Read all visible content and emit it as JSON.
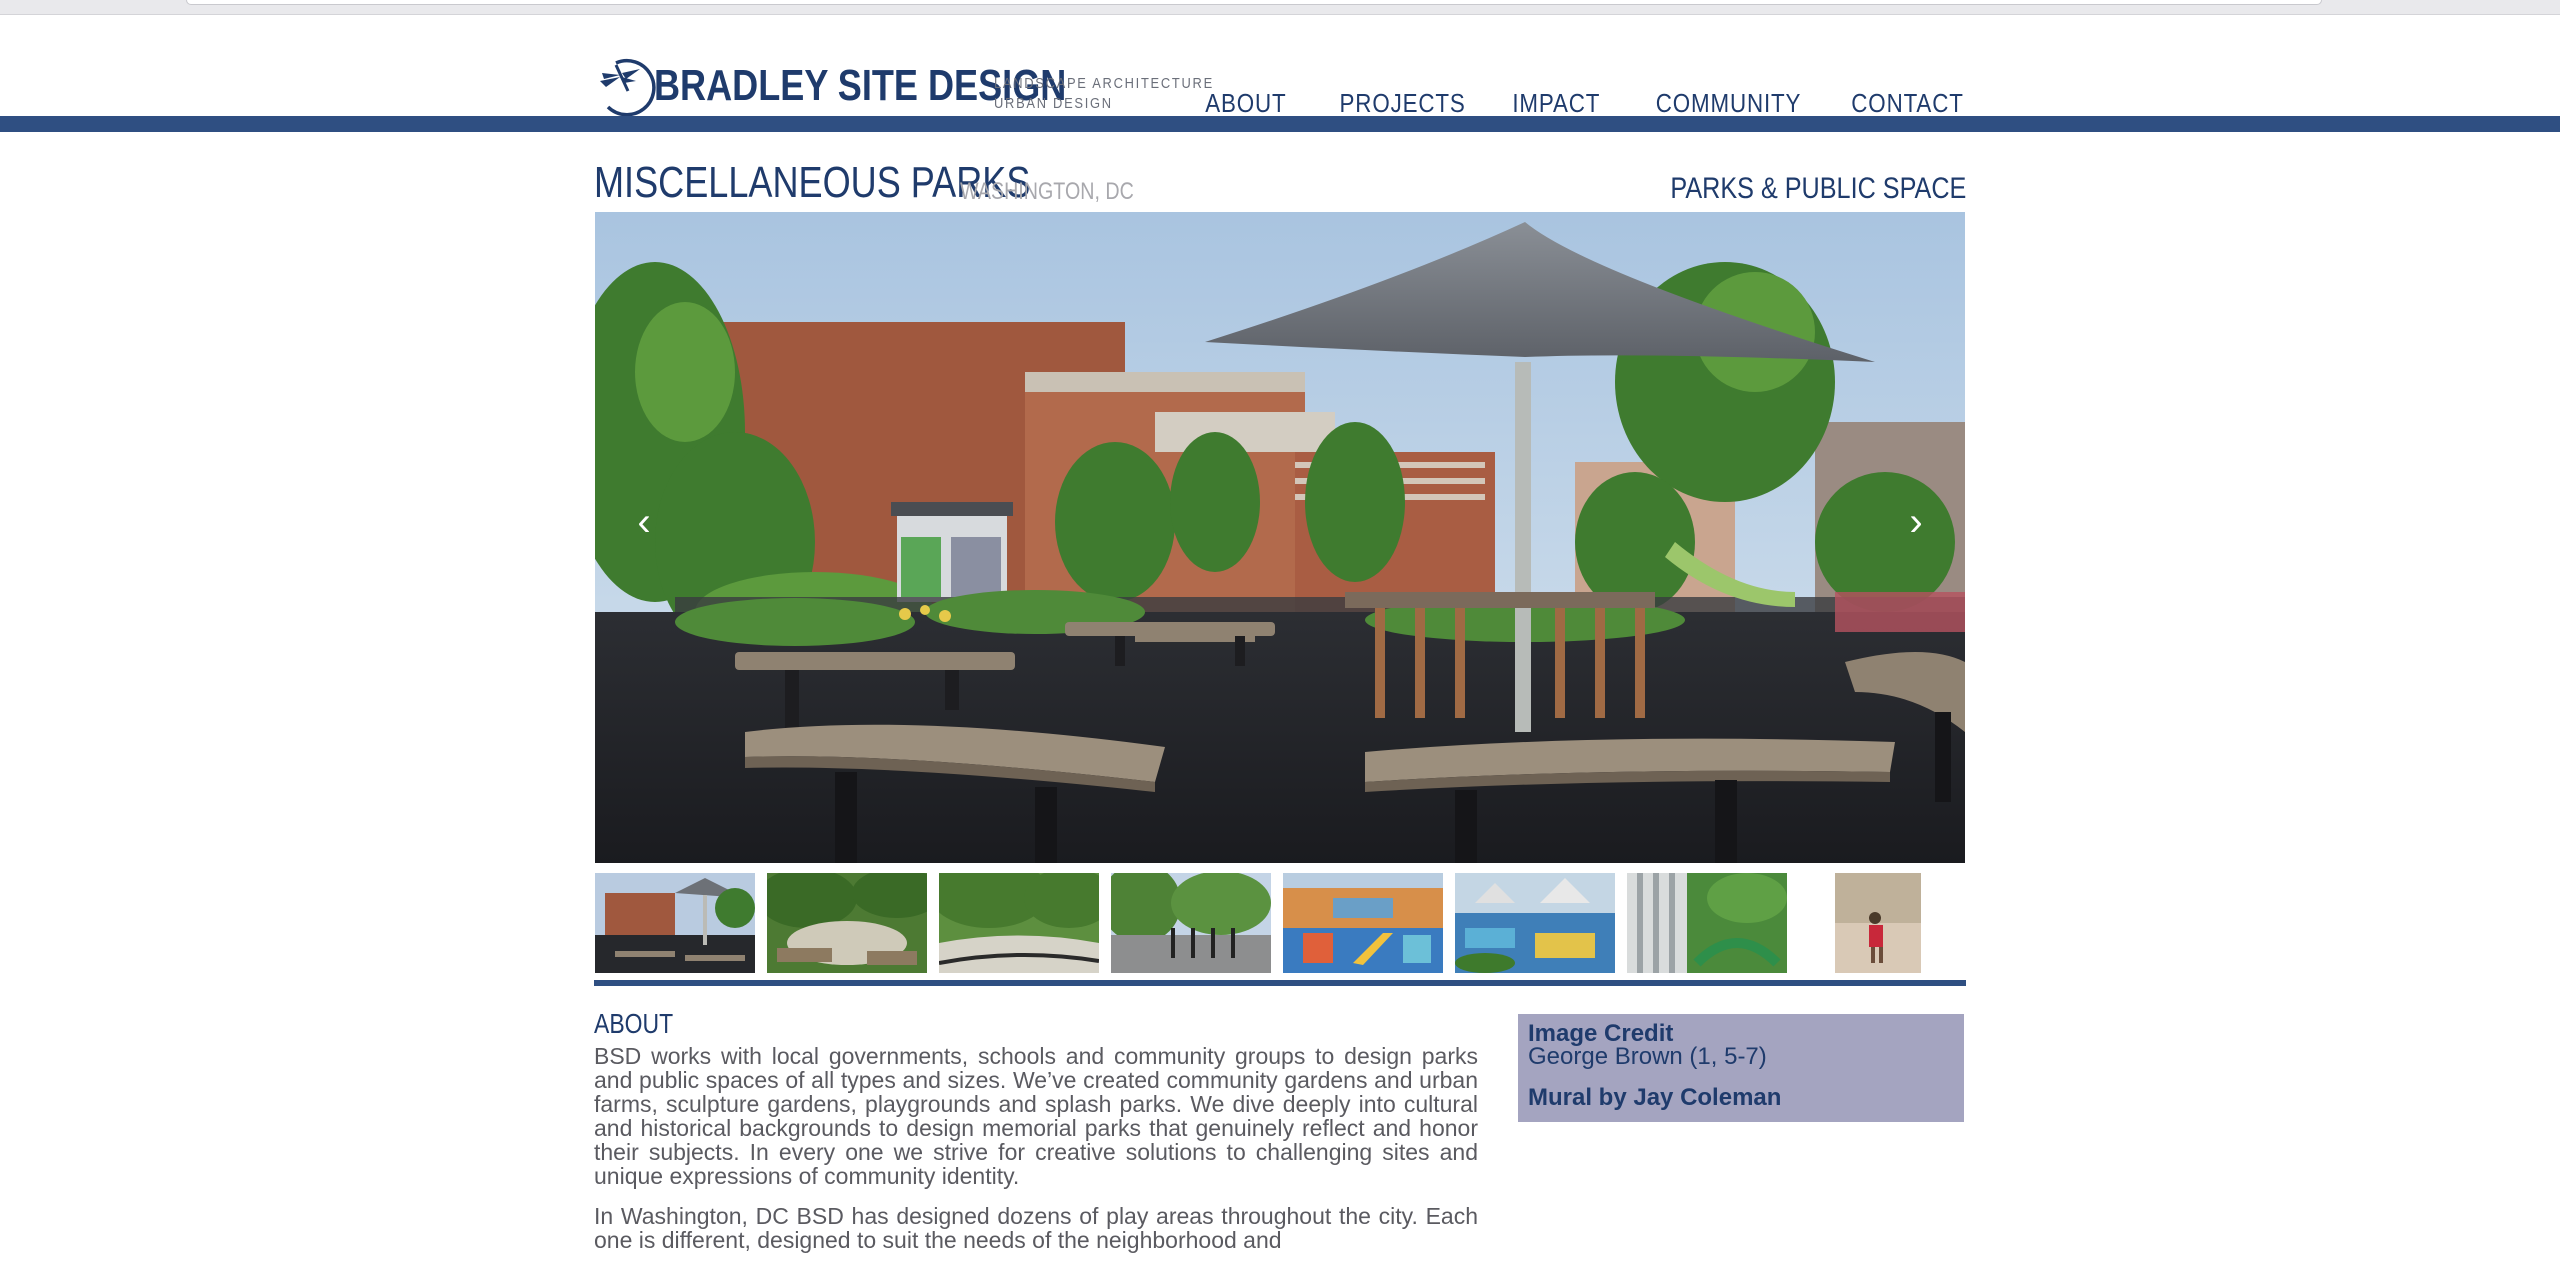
{
  "brand": {
    "name": "BRADLEY SITE DESIGN",
    "tagline_1": "LANDSCAPE ARCHITECTURE",
    "tagline_2": "URBAN DESIGN"
  },
  "nav": [
    "ABOUT",
    "PROJECTS",
    "IMPACT",
    "COMMUNITY",
    "CONTACT"
  ],
  "project": {
    "title": "MISCELLANEOUS PARKS",
    "location": "WASHINGTON, DC",
    "category": "PARKS & PUBLIC SPACE"
  },
  "gallery": {
    "prev_icon": "chevron-left-icon",
    "next_icon": "chevron-right-icon",
    "thumbnail_count": 8
  },
  "about": {
    "heading": "ABOUT",
    "paragraph_1": "BSD works with local governments, schools and community groups to design parks and public spaces of all types and sizes. We’ve created community gardens and urban farms, sculpture gardens, playgrounds and splash parks. We dive deeply into cultural and historical backgrounds to design memorial parks that genuinely reflect and honor their subjects. In every one we strive for creative solutions to challenging sites and unique expressions of community identity.",
    "paragraph_2": "In Washington, DC BSD has designed dozens of play areas throughout the city. Each one is different, designed to suit the needs of the neighborhood and"
  },
  "credits": {
    "title": "Image Credit",
    "photographer": "George Brown (1, 5-7)",
    "mural": "Mural by Jay Coleman"
  },
  "colors": {
    "brand_blue": "#1f3b6c",
    "bar_blue": "#2f4f82",
    "credit_bg": "#a4a4c0"
  }
}
